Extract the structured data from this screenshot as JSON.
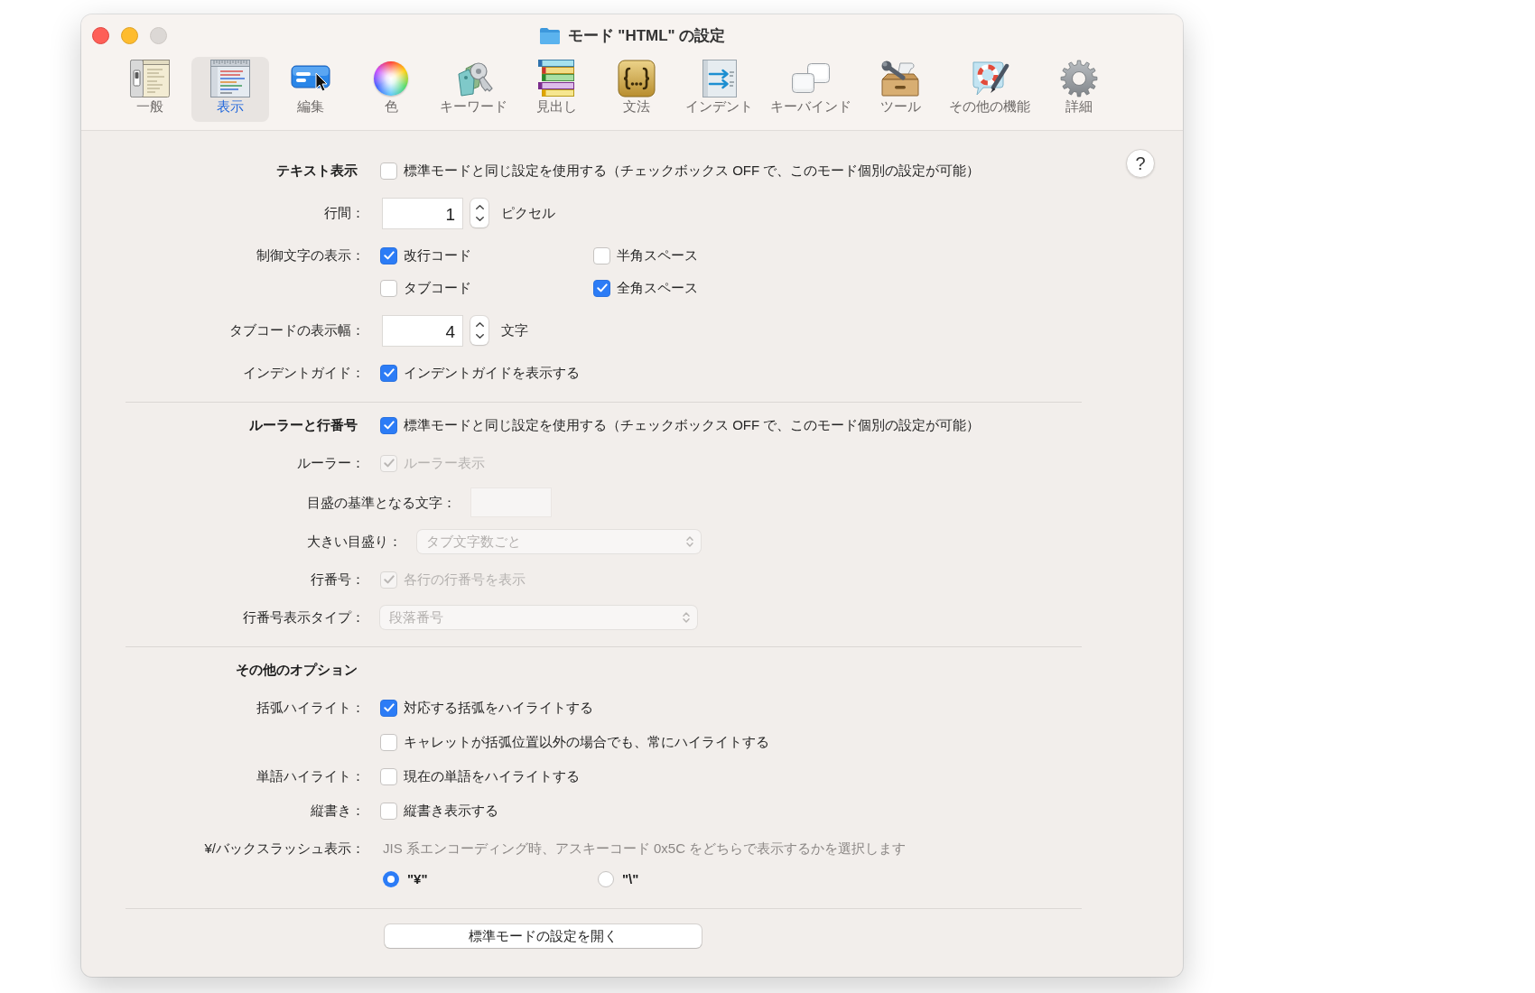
{
  "window": {
    "title": "モード \"HTML\" の設定",
    "controls": [
      {
        "kind": "close",
        "disabled": false
      },
      {
        "kind": "minimize",
        "disabled": false
      },
      {
        "kind": "zoom",
        "disabled": true
      }
    ]
  },
  "toolbar": {
    "tabs": [
      {
        "label": "一般",
        "selected": false
      },
      {
        "label": "表示",
        "selected": true
      },
      {
        "label": "編集",
        "selected": false
      },
      {
        "label": "色",
        "selected": false
      },
      {
        "label": "キーワード",
        "selected": false
      },
      {
        "label": "見出し",
        "selected": false
      },
      {
        "label": "文法",
        "selected": false
      },
      {
        "label": "インデント",
        "selected": false
      },
      {
        "label": "キーバインド",
        "selected": false
      },
      {
        "label": "ツール",
        "selected": false
      },
      {
        "label": "その他の機能",
        "selected": false
      },
      {
        "label": "詳細",
        "selected": false
      }
    ]
  },
  "help_button": {
    "label": "?"
  },
  "sections": [
    {
      "title": "テキスト表示",
      "checkbox": {
        "label": "標準モードと同じ設定を使用する（チェックボックス OFF で、このモード個別の設定が可能）",
        "checked": false,
        "disabled": false
      },
      "rows": [
        {
          "kind": "number",
          "label": "行間：",
          "value": "1",
          "unit": "ピクセル"
        },
        {
          "kind": "checkgrid",
          "label": "制御文字の表示：",
          "options": [
            {
              "label": "改行コード",
              "checked": true,
              "disabled": false
            },
            {
              "label": "半角スペース",
              "checked": false,
              "disabled": false
            },
            {
              "label": "タブコード",
              "checked": false,
              "disabled": false
            },
            {
              "label": "全角スペース",
              "checked": true,
              "disabled": false
            }
          ]
        },
        {
          "kind": "number",
          "label": "タブコードの表示幅：",
          "value": "4",
          "unit": "文字"
        },
        {
          "kind": "checkbox",
          "label": "インデントガイド：",
          "checkbox": {
            "label": "インデントガイドを表示する",
            "checked": true,
            "disabled": false
          }
        }
      ]
    },
    {
      "title": "ルーラーと行番号",
      "checkbox": {
        "label": "標準モードと同じ設定を使用する（チェックボックス OFF で、このモード個別の設定が可能）",
        "checked": true,
        "disabled": false
      },
      "rows": [
        {
          "kind": "checkbox",
          "label": "ルーラー：",
          "checkbox": {
            "label": "ルーラー表示",
            "checked": true,
            "disabled": true
          },
          "children": [
            {
              "kind": "text_field",
              "label": "目盛の基準となる文字：",
              "disabled": true
            },
            {
              "kind": "popup",
              "label": "大きい目盛り：",
              "value": "タブ文字数ごと",
              "disabled": true
            }
          ]
        },
        {
          "kind": "checkbox",
          "label": "行番号：",
          "checkbox": {
            "label": "各行の行番号を表示",
            "checked": true,
            "disabled": true
          }
        },
        {
          "kind": "popup",
          "label": "行番号表示タイプ：",
          "value": "段落番号",
          "disabled": true
        }
      ]
    },
    {
      "title": "その他のオプション",
      "rows": [
        {
          "kind": "checkbox",
          "label": "括弧ハイライト：",
          "checkbox": {
            "label": "対応する括弧をハイライトする",
            "checked": true,
            "disabled": false
          }
        },
        {
          "kind": "checkbox",
          "checkbox": {
            "label": "キャレットが括弧位置以外の場合でも、常にハイライトする",
            "checked": false,
            "disabled": false
          }
        },
        {
          "kind": "checkbox",
          "label": "単語ハイライト：",
          "checkbox": {
            "label": "現在の単語をハイライトする",
            "checked": false,
            "disabled": false
          }
        },
        {
          "kind": "checkbox",
          "label": "縦書き：",
          "checkbox": {
            "label": "縦書き表示する",
            "checked": false,
            "disabled": false
          }
        },
        {
          "kind": "radio",
          "label": "¥/バックスラッシュ表示：",
          "description": "JIS 系エンコーディング時、アスキーコード 0x5C をどちらで表示するかを選択します",
          "options": [
            {
              "label": "\"¥\"",
              "selected": true
            },
            {
              "label": "\"\\\"",
              "selected": false
            }
          ]
        }
      ]
    }
  ],
  "footer_button": {
    "label": "標準モードの設定を開く"
  }
}
